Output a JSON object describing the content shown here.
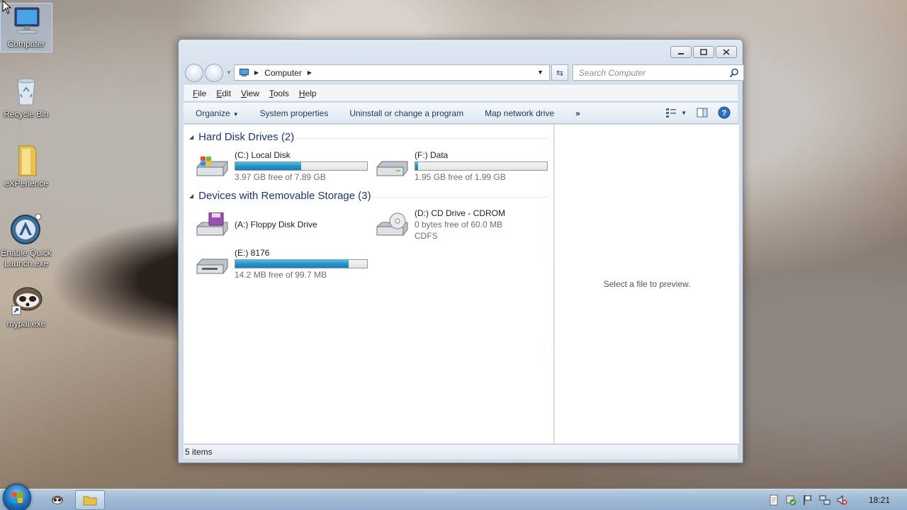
{
  "desktop": {
    "icons": [
      {
        "label": "Computer"
      },
      {
        "label": "Recycle Bin"
      },
      {
        "label": "eXPerience"
      },
      {
        "label": "Enable Quick Launch.exe"
      },
      {
        "label": "mypal.exe"
      }
    ]
  },
  "window": {
    "address": {
      "location": "Computer"
    },
    "search": {
      "placeholder": "Search Computer"
    },
    "menu": {
      "file_pre": "",
      "file_key": "F",
      "file_post": "ile",
      "edit_pre": "",
      "edit_key": "E",
      "edit_post": "dit",
      "view_pre": "",
      "view_key": "V",
      "view_post": "iew",
      "tools_pre": "",
      "tools_key": "T",
      "tools_post": "ools",
      "help_pre": "",
      "help_key": "H",
      "help_post": "elp"
    },
    "commands": {
      "organize": "Organize",
      "system_properties": "System properties",
      "uninstall": "Uninstall or change a program",
      "map_drive": "Map network drive",
      "more": "»"
    },
    "groups": {
      "hard_disks": "Hard Disk Drives (2)",
      "removable": "Devices with Removable Storage (3)"
    },
    "drives": {
      "c": {
        "name": "(C:) Local Disk",
        "free": "3.97 GB free of 7.89 GB",
        "used_fraction": 0.5
      },
      "f": {
        "name": "(F:) Data",
        "free": "1.95 GB free of 1.99 GB",
        "used_fraction": 0.02
      },
      "a": {
        "name": "(A:) Floppy Disk Drive"
      },
      "d": {
        "name": "(D:) CD Drive - CDROM",
        "free": "0 bytes free of 60.0 MB",
        "fs": "CDFS"
      },
      "e": {
        "name": "(E:) 8176",
        "free": "14.2 MB free of 99.7 MB",
        "used_fraction": 0.86
      }
    },
    "preview_text": "Select a file to preview.",
    "status": "5 items"
  },
  "taskbar": {
    "clock": "18:21"
  },
  "colors": {
    "group_heading": "#1e3287",
    "bar_fill": "#2394c8",
    "taskbar": "#a2bcd6"
  }
}
